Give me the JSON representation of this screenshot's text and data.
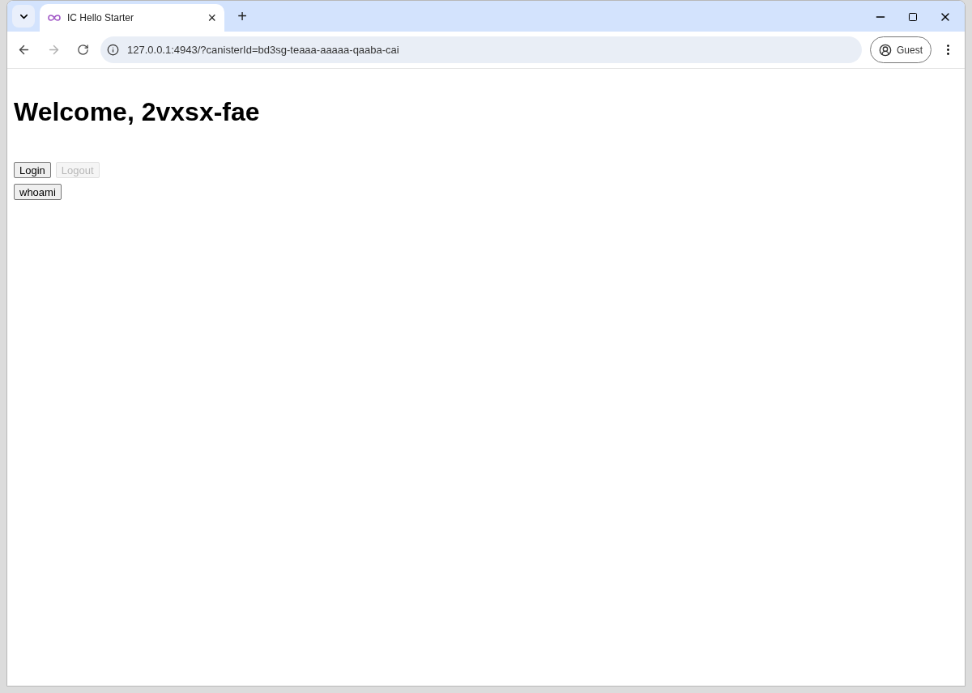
{
  "tab": {
    "title": "IC Hello Starter",
    "close": "×",
    "new": "+"
  },
  "address_bar": {
    "url": "127.0.0.1:4943/?canisterId=bd3sg-teaaa-aaaaa-qaaba-cai"
  },
  "profile": {
    "label": "Guest"
  },
  "page": {
    "heading": "Welcome, 2vxsx-fae",
    "button_rows": [
      [
        {
          "label": "Login",
          "disabled": false
        },
        {
          "label": "Logout",
          "disabled": true
        }
      ],
      [
        {
          "label": "whoami",
          "disabled": false
        }
      ]
    ]
  }
}
